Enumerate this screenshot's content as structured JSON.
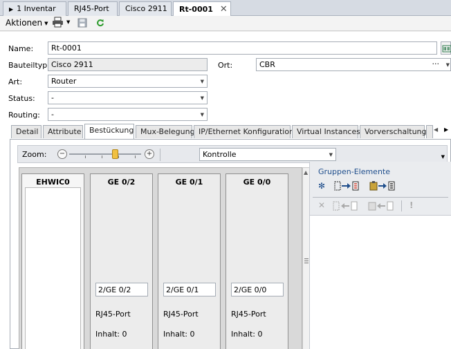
{
  "doc_tabs": [
    {
      "label": "1 Inventar"
    },
    {
      "label": "RJ45-Port"
    },
    {
      "label": "Cisco 2911"
    },
    {
      "label": "Rt-0001"
    }
  ],
  "toolbar": {
    "actions_label": "Aktionen"
  },
  "form": {
    "name_label": "Name:",
    "name_value": "Rt-0001",
    "bauteiltyp_label": "Bauteiltyp:",
    "bauteiltyp_value": "Cisco 2911",
    "ort_label": "Ort:",
    "ort_value": "CBR",
    "ort_more": "···",
    "art_label": "Art:",
    "art_value": "Router",
    "status_label": "Status:",
    "status_value": "-",
    "routing_label": "Routing:",
    "routing_value": "-"
  },
  "section_tabs": [
    {
      "label": "Detail"
    },
    {
      "label": "Attribute"
    },
    {
      "label": "Bestückung"
    },
    {
      "label": "Mux-Belegung"
    },
    {
      "label": "IP/Ethernet Konfiguration"
    },
    {
      "label": "Virtual Instances"
    },
    {
      "label": "Vorverschaltung"
    }
  ],
  "zoom": {
    "label": "Zoom:",
    "view_value": "Kontrolle"
  },
  "slots": [
    {
      "title": "EHWIC0"
    },
    {
      "title": "GE 0/2",
      "port": "2/GE 0/2",
      "type": "RJ45-Port",
      "count": "Inhalt: 0"
    },
    {
      "title": "GE 0/1",
      "port": "2/GE 0/1",
      "type": "RJ45-Port",
      "count": "Inhalt: 0"
    },
    {
      "title": "GE 0/0",
      "port": "2/GE 0/0",
      "type": "RJ45-Port",
      "count": "Inhalt: 0"
    }
  ],
  "group_panel": {
    "title": "Gruppen-Elemente"
  },
  "colors": {
    "accent": "#1f4e8c",
    "link": "#1f4e8c"
  }
}
